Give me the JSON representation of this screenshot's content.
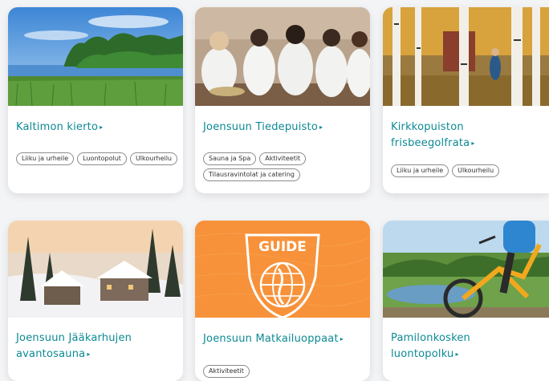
{
  "cards": [
    {
      "title_lines": [
        "Kaltimon kierto"
      ],
      "tags": [
        "Liiku ja urheile",
        "Luontopolut",
        "Ulkourheilu"
      ]
    },
    {
      "title_lines": [
        "Joensuun Tiedepuisto"
      ],
      "tags": [
        "Sauna ja Spa",
        "Aktiviteetit",
        "Tilausravintolat ja catering"
      ]
    },
    {
      "title_lines": [
        "Kirkkopuiston",
        "frisbeegolfrata"
      ],
      "tags": [
        "Liiku ja urheile",
        "Ulkourheilu"
      ]
    },
    {
      "title_lines": [
        "Joensuun Jääkarhujen",
        "avantosauna"
      ],
      "tags": []
    },
    {
      "title_lines": [
        "Joensuun Matkailuoppaat"
      ],
      "tags": [
        "Aktiviteetit"
      ],
      "logo_text": "GUIDE"
    },
    {
      "title_lines": [
        "Pamilonkosken",
        "luontopolku"
      ],
      "tags": []
    }
  ],
  "arrow_glyph": "▸",
  "colors": {
    "title": "#0c8a94",
    "guide_orange": "#f7923a",
    "card_bg": "#ffffff",
    "page_bg": "#f3f4f6"
  }
}
